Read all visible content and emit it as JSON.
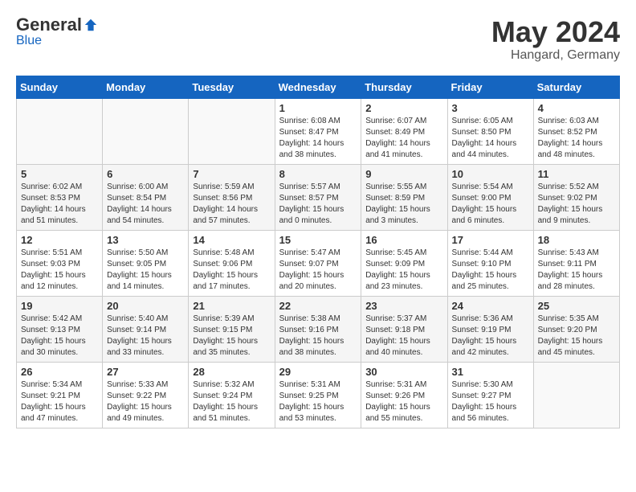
{
  "header": {
    "logo_general": "General",
    "logo_blue": "Blue",
    "month": "May 2024",
    "location": "Hangard, Germany"
  },
  "weekdays": [
    "Sunday",
    "Monday",
    "Tuesday",
    "Wednesday",
    "Thursday",
    "Friday",
    "Saturday"
  ],
  "weeks": [
    [
      {
        "day": "",
        "info": ""
      },
      {
        "day": "",
        "info": ""
      },
      {
        "day": "",
        "info": ""
      },
      {
        "day": "1",
        "info": "Sunrise: 6:08 AM\nSunset: 8:47 PM\nDaylight: 14 hours\nand 38 minutes."
      },
      {
        "day": "2",
        "info": "Sunrise: 6:07 AM\nSunset: 8:49 PM\nDaylight: 14 hours\nand 41 minutes."
      },
      {
        "day": "3",
        "info": "Sunrise: 6:05 AM\nSunset: 8:50 PM\nDaylight: 14 hours\nand 44 minutes."
      },
      {
        "day": "4",
        "info": "Sunrise: 6:03 AM\nSunset: 8:52 PM\nDaylight: 14 hours\nand 48 minutes."
      }
    ],
    [
      {
        "day": "5",
        "info": "Sunrise: 6:02 AM\nSunset: 8:53 PM\nDaylight: 14 hours\nand 51 minutes."
      },
      {
        "day": "6",
        "info": "Sunrise: 6:00 AM\nSunset: 8:54 PM\nDaylight: 14 hours\nand 54 minutes."
      },
      {
        "day": "7",
        "info": "Sunrise: 5:59 AM\nSunset: 8:56 PM\nDaylight: 14 hours\nand 57 minutes."
      },
      {
        "day": "8",
        "info": "Sunrise: 5:57 AM\nSunset: 8:57 PM\nDaylight: 15 hours\nand 0 minutes."
      },
      {
        "day": "9",
        "info": "Sunrise: 5:55 AM\nSunset: 8:59 PM\nDaylight: 15 hours\nand 3 minutes."
      },
      {
        "day": "10",
        "info": "Sunrise: 5:54 AM\nSunset: 9:00 PM\nDaylight: 15 hours\nand 6 minutes."
      },
      {
        "day": "11",
        "info": "Sunrise: 5:52 AM\nSunset: 9:02 PM\nDaylight: 15 hours\nand 9 minutes."
      }
    ],
    [
      {
        "day": "12",
        "info": "Sunrise: 5:51 AM\nSunset: 9:03 PM\nDaylight: 15 hours\nand 12 minutes."
      },
      {
        "day": "13",
        "info": "Sunrise: 5:50 AM\nSunset: 9:05 PM\nDaylight: 15 hours\nand 14 minutes."
      },
      {
        "day": "14",
        "info": "Sunrise: 5:48 AM\nSunset: 9:06 PM\nDaylight: 15 hours\nand 17 minutes."
      },
      {
        "day": "15",
        "info": "Sunrise: 5:47 AM\nSunset: 9:07 PM\nDaylight: 15 hours\nand 20 minutes."
      },
      {
        "day": "16",
        "info": "Sunrise: 5:45 AM\nSunset: 9:09 PM\nDaylight: 15 hours\nand 23 minutes."
      },
      {
        "day": "17",
        "info": "Sunrise: 5:44 AM\nSunset: 9:10 PM\nDaylight: 15 hours\nand 25 minutes."
      },
      {
        "day": "18",
        "info": "Sunrise: 5:43 AM\nSunset: 9:11 PM\nDaylight: 15 hours\nand 28 minutes."
      }
    ],
    [
      {
        "day": "19",
        "info": "Sunrise: 5:42 AM\nSunset: 9:13 PM\nDaylight: 15 hours\nand 30 minutes."
      },
      {
        "day": "20",
        "info": "Sunrise: 5:40 AM\nSunset: 9:14 PM\nDaylight: 15 hours\nand 33 minutes."
      },
      {
        "day": "21",
        "info": "Sunrise: 5:39 AM\nSunset: 9:15 PM\nDaylight: 15 hours\nand 35 minutes."
      },
      {
        "day": "22",
        "info": "Sunrise: 5:38 AM\nSunset: 9:16 PM\nDaylight: 15 hours\nand 38 minutes."
      },
      {
        "day": "23",
        "info": "Sunrise: 5:37 AM\nSunset: 9:18 PM\nDaylight: 15 hours\nand 40 minutes."
      },
      {
        "day": "24",
        "info": "Sunrise: 5:36 AM\nSunset: 9:19 PM\nDaylight: 15 hours\nand 42 minutes."
      },
      {
        "day": "25",
        "info": "Sunrise: 5:35 AM\nSunset: 9:20 PM\nDaylight: 15 hours\nand 45 minutes."
      }
    ],
    [
      {
        "day": "26",
        "info": "Sunrise: 5:34 AM\nSunset: 9:21 PM\nDaylight: 15 hours\nand 47 minutes."
      },
      {
        "day": "27",
        "info": "Sunrise: 5:33 AM\nSunset: 9:22 PM\nDaylight: 15 hours\nand 49 minutes."
      },
      {
        "day": "28",
        "info": "Sunrise: 5:32 AM\nSunset: 9:24 PM\nDaylight: 15 hours\nand 51 minutes."
      },
      {
        "day": "29",
        "info": "Sunrise: 5:31 AM\nSunset: 9:25 PM\nDaylight: 15 hours\nand 53 minutes."
      },
      {
        "day": "30",
        "info": "Sunrise: 5:31 AM\nSunset: 9:26 PM\nDaylight: 15 hours\nand 55 minutes."
      },
      {
        "day": "31",
        "info": "Sunrise: 5:30 AM\nSunset: 9:27 PM\nDaylight: 15 hours\nand 56 minutes."
      },
      {
        "day": "",
        "info": ""
      }
    ]
  ]
}
